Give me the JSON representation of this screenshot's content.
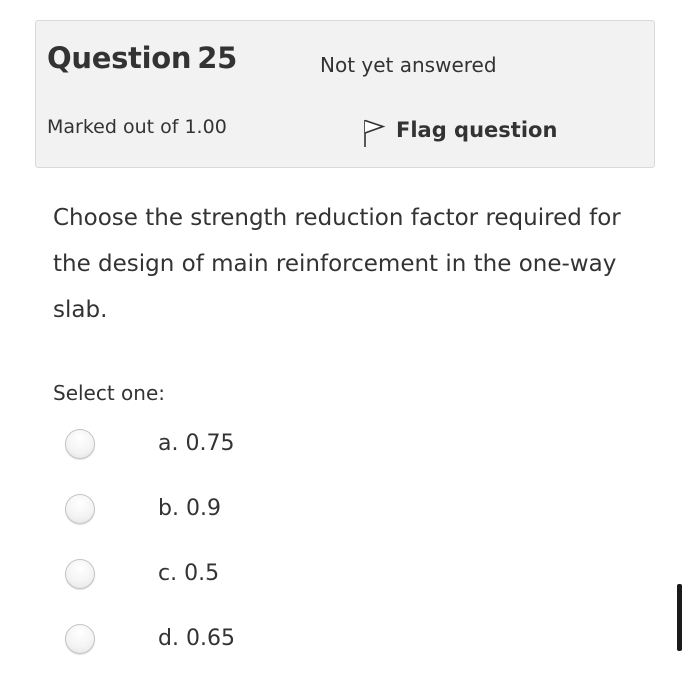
{
  "info": {
    "question_label": "Question",
    "question_number": "25",
    "state": "Not yet answered",
    "grade": "Marked out of 1.00",
    "flag_label": "Flag question"
  },
  "question": {
    "text": "Choose the strength reduction factor required for the design of main reinforcement in the one-way slab."
  },
  "answers": {
    "prompt": "Select one:",
    "options": [
      {
        "label": "a. 0.75"
      },
      {
        "label": "b. 0.9"
      },
      {
        "label": "c. 0.5"
      },
      {
        "label": "d. 0.65"
      }
    ]
  },
  "colors": {
    "info_background": "#f2f2f2",
    "info_border": "#d9d9d9",
    "text": "#333333"
  },
  "icons": {
    "flag": "flag-outline-icon"
  }
}
